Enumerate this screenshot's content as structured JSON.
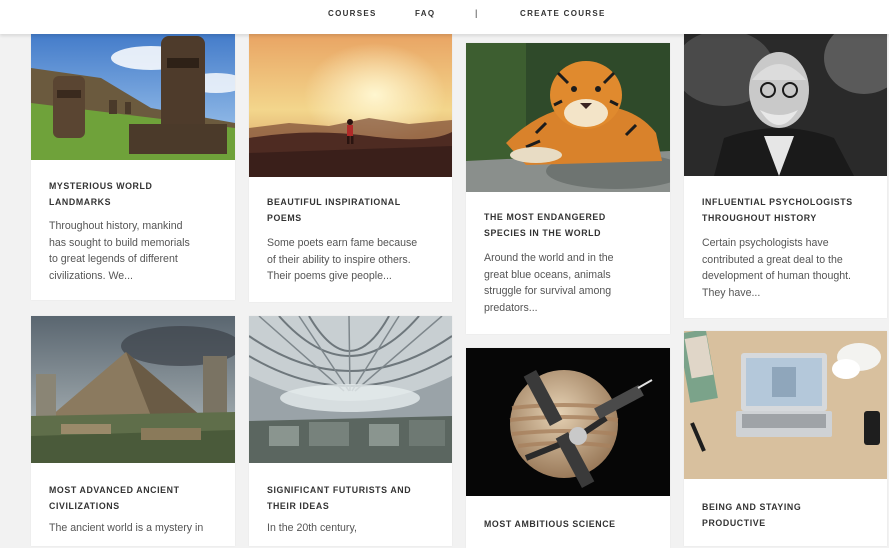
{
  "nav": {
    "items": [
      "COURSES",
      "FAQ",
      "CREATE COURSE"
    ],
    "separator": "|"
  },
  "cards": [
    {
      "title_line1": "MYSTERIOUS WORLD",
      "title_line2": "LANDMARKS",
      "excerpt": [
        "Throughout history, mankind",
        "has sought to build memorials",
        "to great legends of different",
        "civilizations. We..."
      ]
    },
    {
      "title_line1": "BEAUTIFUL INSPIRATIONAL",
      "title_line2": "POEMS",
      "excerpt": [
        "Some poets earn fame because",
        "of their ability to inspire others.",
        "Their poems give people..."
      ]
    },
    {
      "title_line1": "THE MOST ENDANGERED",
      "title_line2": "SPECIES IN THE WORLD",
      "excerpt": [
        "Around the world and in the",
        "great blue oceans, animals",
        "struggle for survival among",
        "predators..."
      ]
    },
    {
      "title_line1": "INFLUENTIAL PSYCHOLOGISTS",
      "title_line2": "THROUGHOUT HISTORY",
      "excerpt": [
        "Certain psychologists have",
        "contributed a great deal to the",
        "development of human thought.",
        "They have..."
      ]
    },
    {
      "title_line1": "MOST ADVANCED ANCIENT",
      "title_line2": "CIVILIZATIONS",
      "excerpt": [
        "The ancient world is a mystery in"
      ]
    },
    {
      "title_line1": "SIGNIFICANT FUTURISTS AND",
      "title_line2": "THEIR IDEAS",
      "excerpt": [
        "In the 20th century,"
      ]
    },
    {
      "title_line1": "MOST AMBITIOUS SCIENCE",
      "title_line2": "",
      "excerpt": []
    },
    {
      "title_line1": "BEING AND STAYING",
      "title_line2": "PRODUCTIVE",
      "excerpt": []
    }
  ]
}
